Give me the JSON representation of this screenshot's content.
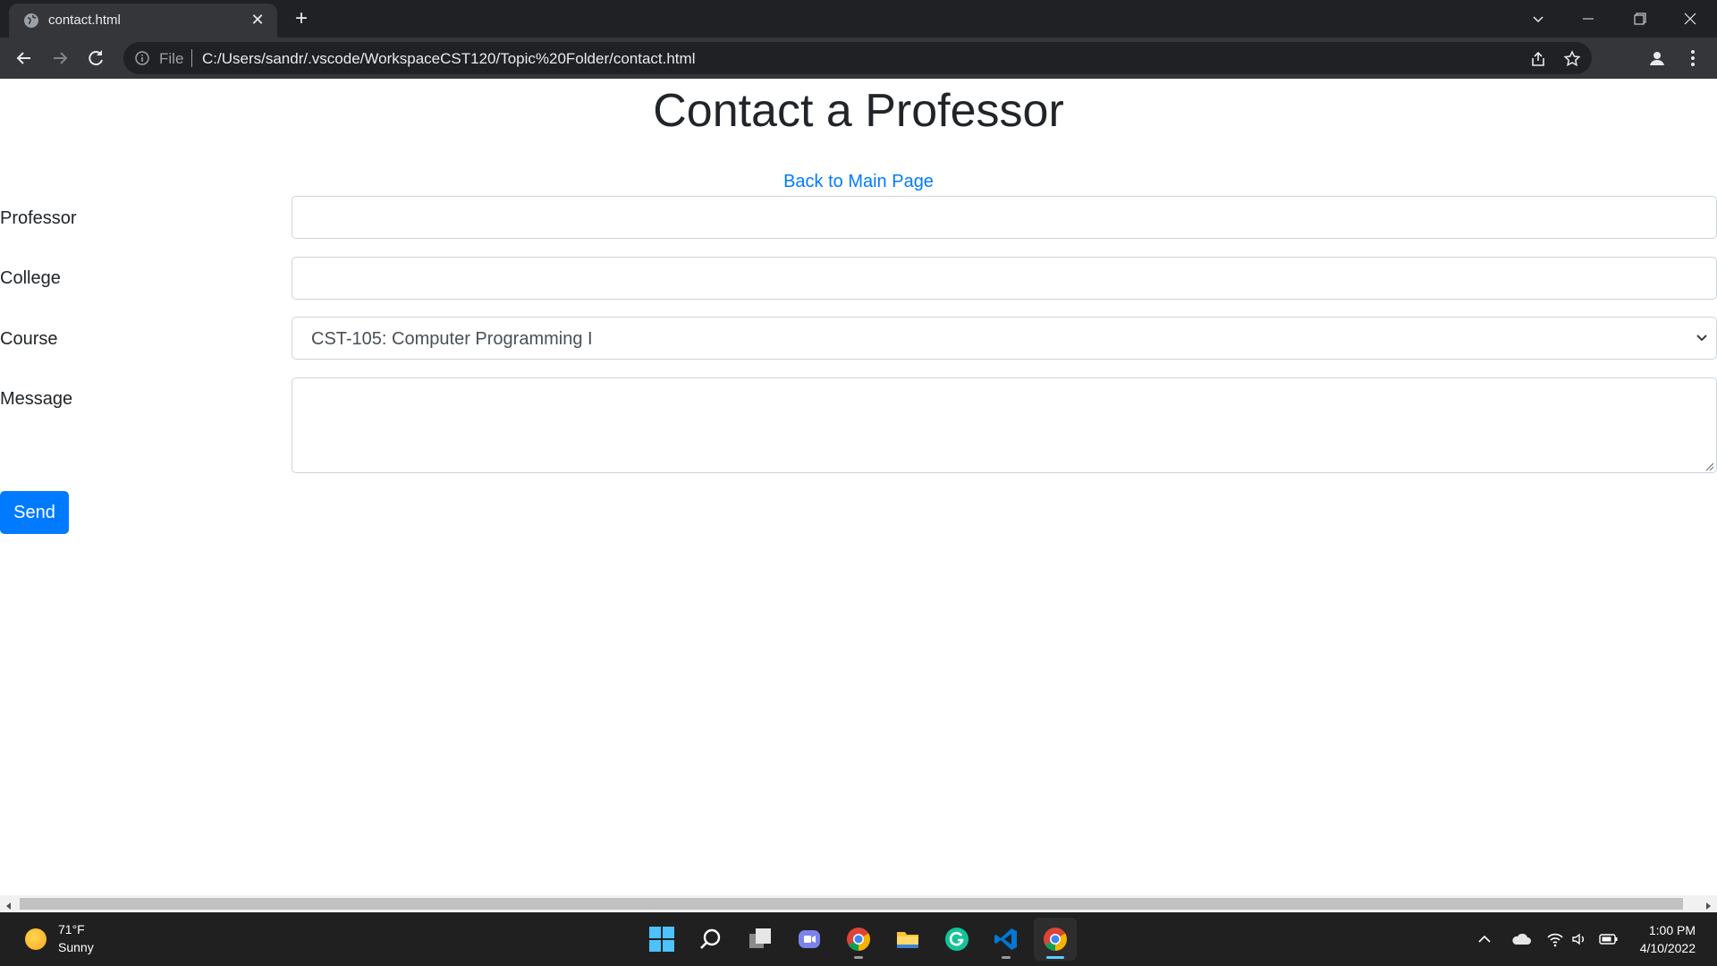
{
  "browser": {
    "tab_title": "contact.html",
    "scheme_label": "File",
    "url": "C:/Users/sandr/.vscode/WorkspaceCST120/Topic%20Folder/contact.html"
  },
  "page": {
    "heading": "Contact a Professor",
    "back_link": "Back to Main Page",
    "form": {
      "professor_label": "Professor",
      "professor_value": "",
      "college_label": "College",
      "college_value": "",
      "course_label": "Course",
      "course_selected": "CST-105: Computer Programming I",
      "message_label": "Message",
      "message_value": "",
      "send_label": "Send"
    }
  },
  "taskbar": {
    "weather_temp": "71°F",
    "weather_condition": "Sunny",
    "time": "1:00 PM",
    "date": "4/10/2022",
    "apps": [
      "start-icon",
      "search-icon",
      "task-view-icon",
      "teams-chat-icon",
      "chrome-icon",
      "file-explorer-icon",
      "grammarly-icon",
      "vscode-icon",
      "chrome-icon"
    ]
  },
  "colors": {
    "link": "#007bff",
    "button": "#007bff",
    "chrome_dark": "#202124",
    "taskbar": "#202020"
  }
}
